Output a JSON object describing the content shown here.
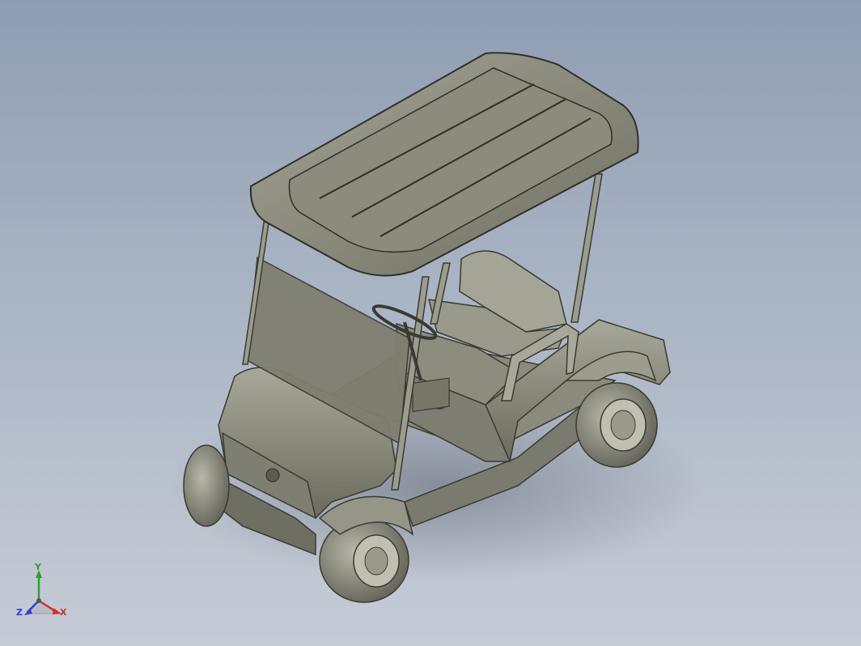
{
  "viewport": {
    "background_top": "#8f9db3",
    "background_bottom": "#c6ccd6",
    "model": {
      "name": "golf-cart",
      "body_color": "#8e8e80",
      "body_shadow": "#5a5a50",
      "highlight": "#c9c9bb"
    }
  },
  "triad": {
    "x_label": "X",
    "y_label": "Y",
    "z_label": "Z",
    "x_color": "#d03030",
    "y_color": "#30a030",
    "z_color": "#3040d0"
  }
}
